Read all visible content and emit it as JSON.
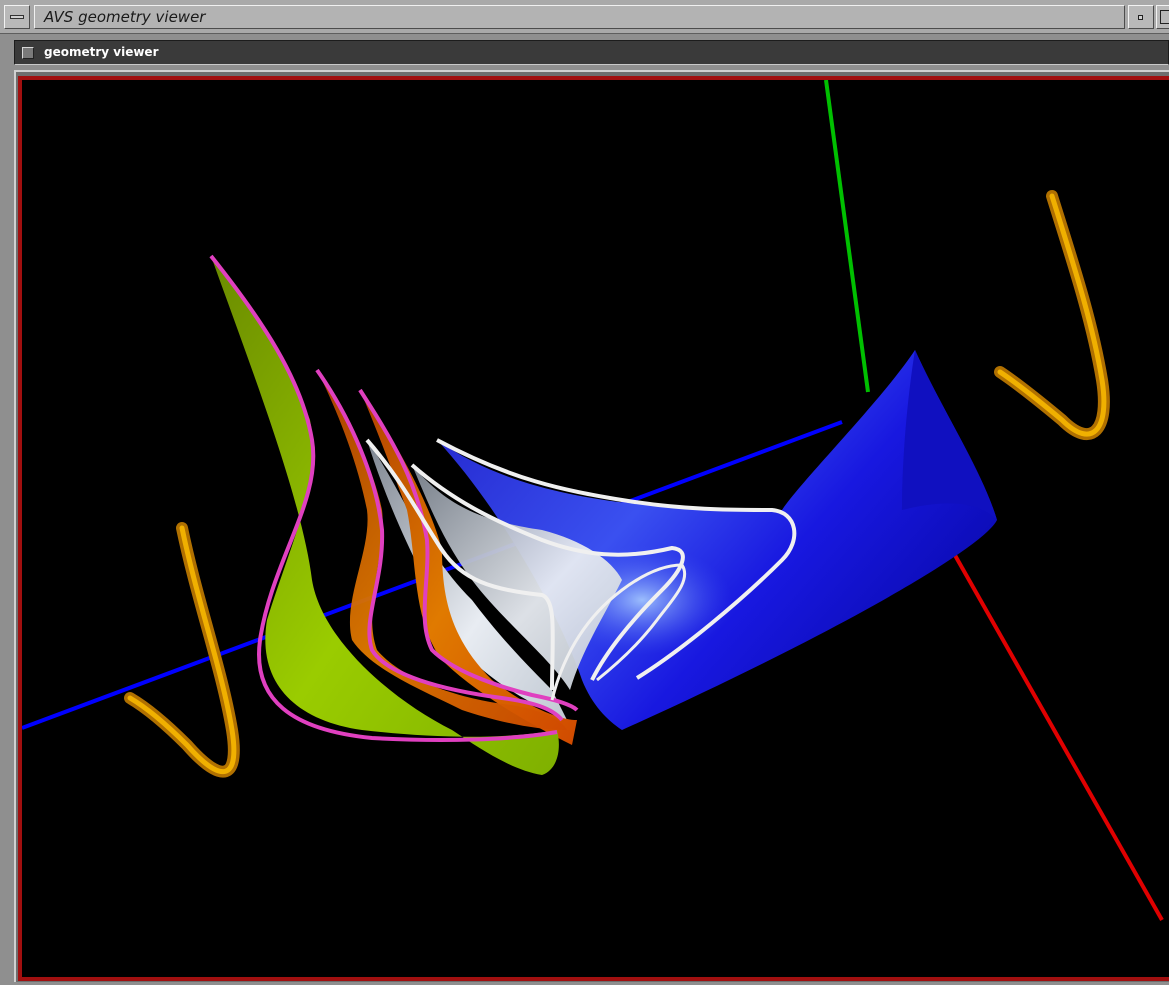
{
  "window": {
    "title": "AVS geometry viewer",
    "menu_icon": "window-menu-icon",
    "minimize_icon": "minimize-icon",
    "maximize_icon": "maximize-icon"
  },
  "module": {
    "label": "geometry viewer",
    "toggle_icon": "module-toggle-icon"
  },
  "scene": {
    "axis_colors": {
      "x": "#e00000",
      "y": "#00c000",
      "z": "#0000ff"
    },
    "tube_color": "#e8a000",
    "surface_colors": [
      "#9acc00",
      "#e07800",
      "#e8e8f0",
      "#2020e0"
    ],
    "curve_colors": {
      "outer": "#e040c0",
      "inner": "#f0f0f0"
    },
    "frame_color": "#a10f0f"
  }
}
